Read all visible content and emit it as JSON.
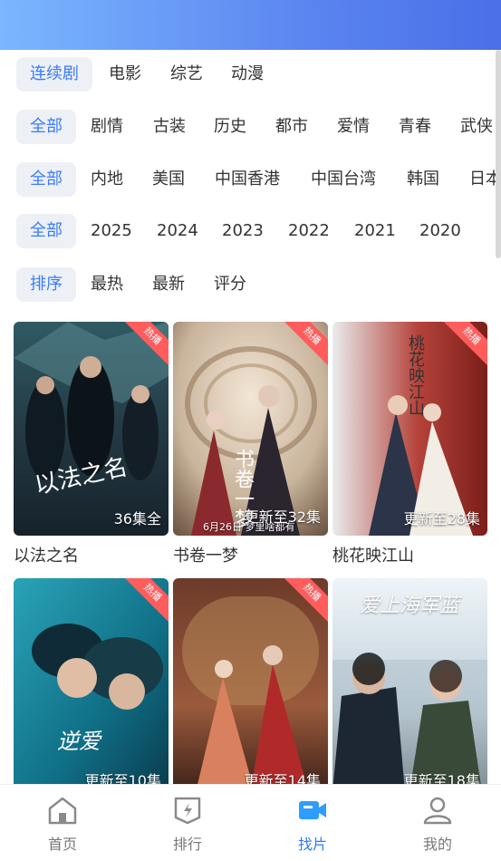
{
  "filters": {
    "type": [
      "连续剧",
      "电影",
      "综艺",
      "动漫"
    ],
    "genre": [
      "全部",
      "剧情",
      "古装",
      "历史",
      "都市",
      "爱情",
      "青春",
      "武侠"
    ],
    "region": [
      "全部",
      "内地",
      "美国",
      "中国香港",
      "中国台湾",
      "韩国",
      "日本"
    ],
    "year": [
      "全部",
      "2025",
      "2024",
      "2023",
      "2022",
      "2021",
      "2020"
    ],
    "sort": [
      "排序",
      "最热",
      "最新",
      "评分"
    ]
  },
  "cards": [
    {
      "title": "以法之名",
      "episodes": "36集全",
      "badge": "热播",
      "poster_text": "以法之名"
    },
    {
      "title": "书卷一梦",
      "episodes": "更新至32集",
      "badge": "热播",
      "poster_text": "书卷一梦",
      "date_line": "6月26日 梦里啥都有"
    },
    {
      "title": "桃花映江山",
      "episodes": "更新至28集",
      "badge": "热播",
      "poster_text": "桃花映江山"
    },
    {
      "title": "",
      "episodes": "更新至10集",
      "badge": "热播",
      "poster_text": "逆爱"
    },
    {
      "title": "",
      "episodes": "更新至14集",
      "badge": "热播",
      "poster_text": ""
    },
    {
      "title": "",
      "episodes": "更新至18集",
      "badge": "",
      "poster_text": "爱上海军蓝"
    }
  ],
  "tabs": [
    {
      "label": "首页"
    },
    {
      "label": "排行"
    },
    {
      "label": "找片"
    },
    {
      "label": "我的"
    }
  ],
  "colors": {
    "accent": "#3a7bff",
    "hot": "#ff5c5c",
    "chip_bg": "#edf0f5"
  }
}
